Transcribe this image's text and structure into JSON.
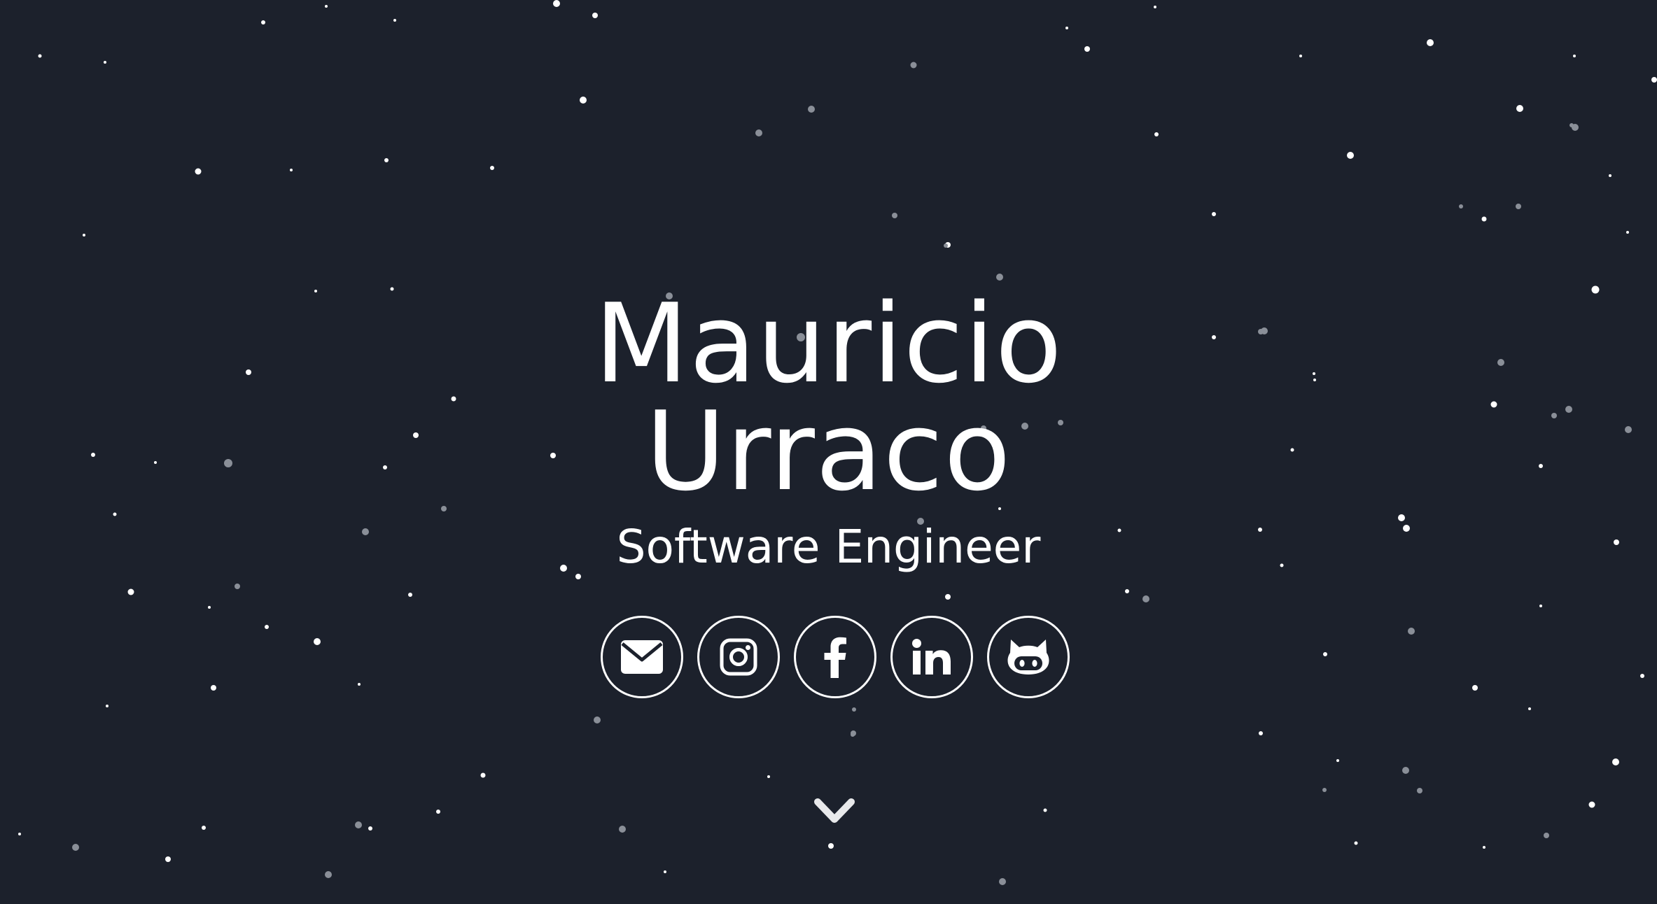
{
  "hero": {
    "name_line1": "Mauricio",
    "name_line2": "Urraco",
    "title": "Software Engineer"
  },
  "social_links": [
    {
      "name": "email",
      "icon": "envelope-icon"
    },
    {
      "name": "instagram",
      "icon": "instagram-icon"
    },
    {
      "name": "facebook",
      "icon": "facebook-icon"
    },
    {
      "name": "linkedin",
      "icon": "linkedin-icon"
    },
    {
      "name": "github",
      "icon": "github-icon"
    }
  ],
  "scroll_indicator": {
    "icon": "chevron-down-icon"
  },
  "colors": {
    "background": "#1c212c",
    "foreground": "#ffffff",
    "star_dim": "#6b7079"
  }
}
